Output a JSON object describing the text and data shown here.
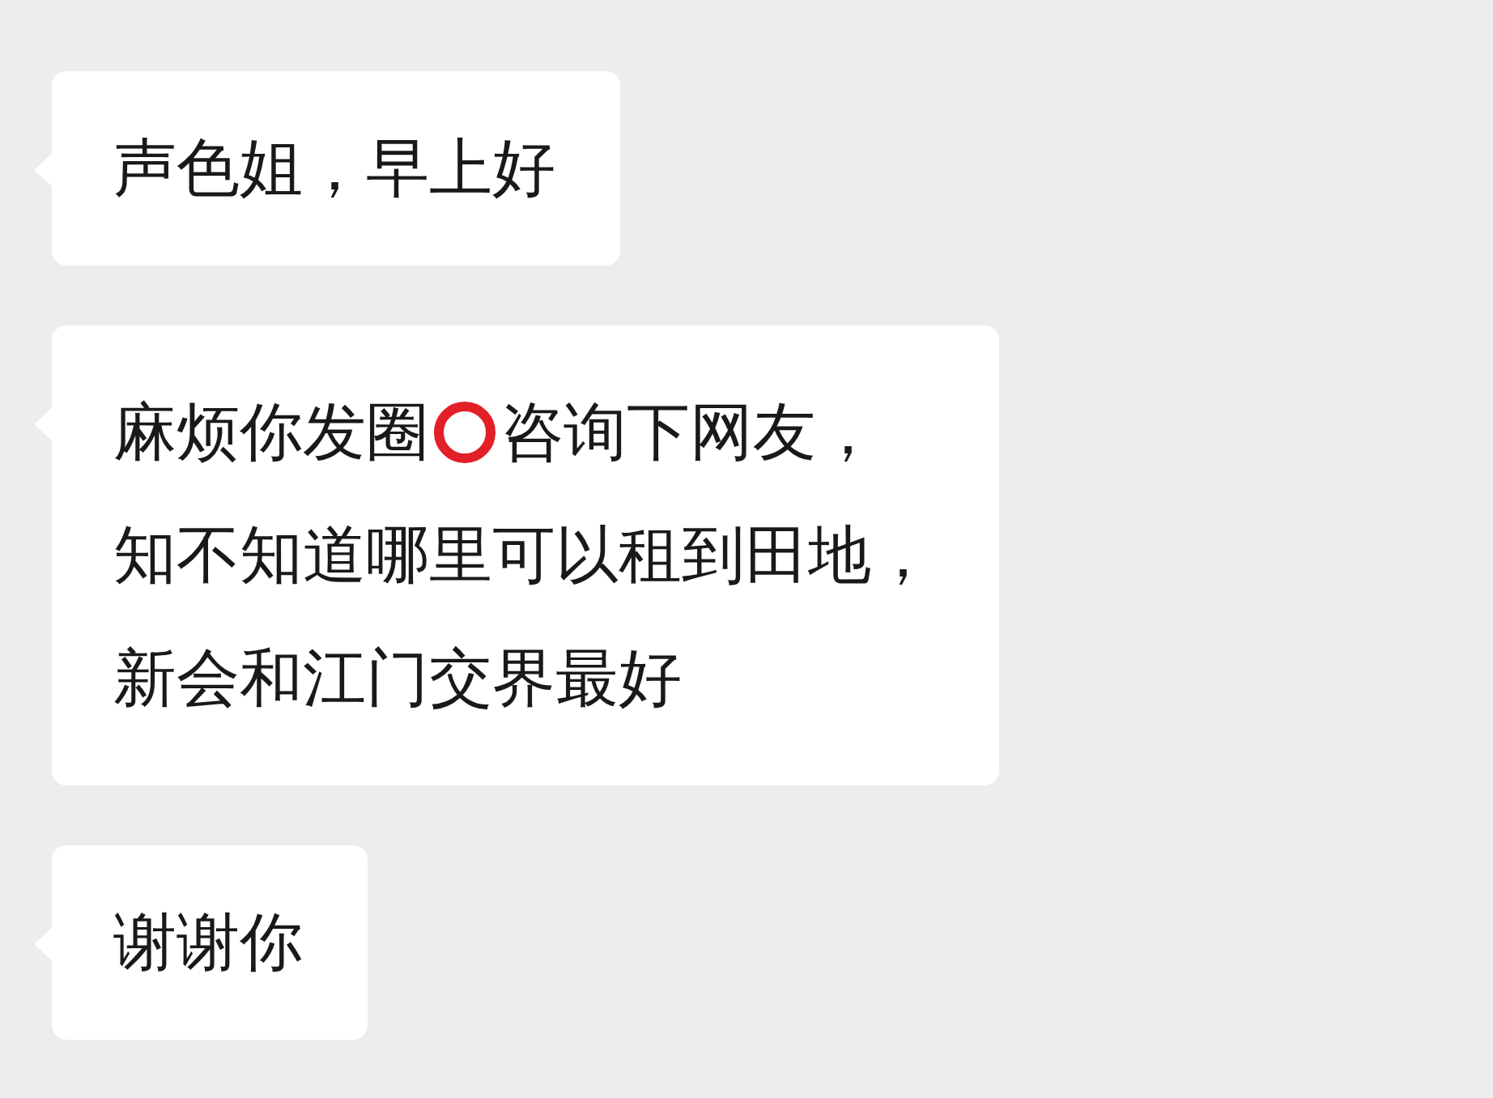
{
  "messages": [
    {
      "lines": [
        [
          {
            "kind": "text",
            "text": "声色姐，早上好"
          }
        ]
      ]
    },
    {
      "lines": [
        [
          {
            "kind": "text",
            "text": "麻烦你发圈"
          },
          {
            "kind": "ring"
          },
          {
            "kind": "text",
            "text": "咨询下网友，"
          }
        ],
        [
          {
            "kind": "text",
            "text": "知不知道哪里可以租到田地，"
          }
        ],
        [
          {
            "kind": "text",
            "text": "新会和江门交界最好"
          }
        ]
      ]
    },
    {
      "lines": [
        [
          {
            "kind": "text",
            "text": "谢谢你"
          }
        ]
      ]
    }
  ]
}
